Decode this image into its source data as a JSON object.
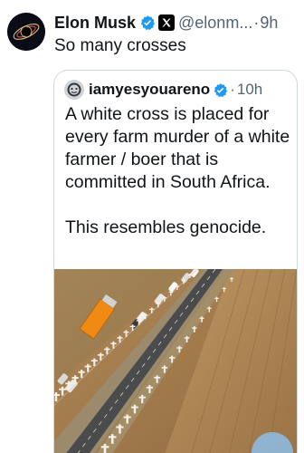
{
  "tweet": {
    "author_name": "Elon Musk",
    "handle": "@elonm...",
    "separator": "·",
    "time": "9h",
    "text": "So many crosses",
    "avatar_icon": "avatar-image",
    "verified_icon": "verified-badge-icon",
    "affiliation_icon": "x-logo-icon"
  },
  "quote": {
    "author_name": "iamyesyouareno",
    "separator": "·",
    "time": "10h",
    "paragraphs": [
      "A white cross is placed for every farm murder of a white farmer / boer that is committed in South Africa.",
      "This resembles genocide."
    ],
    "media_icon": "aerial-road-photo"
  },
  "colors": {
    "verified_blue": "#1d9bf0",
    "secondary_text": "#536471",
    "border": "#cfd9de"
  }
}
